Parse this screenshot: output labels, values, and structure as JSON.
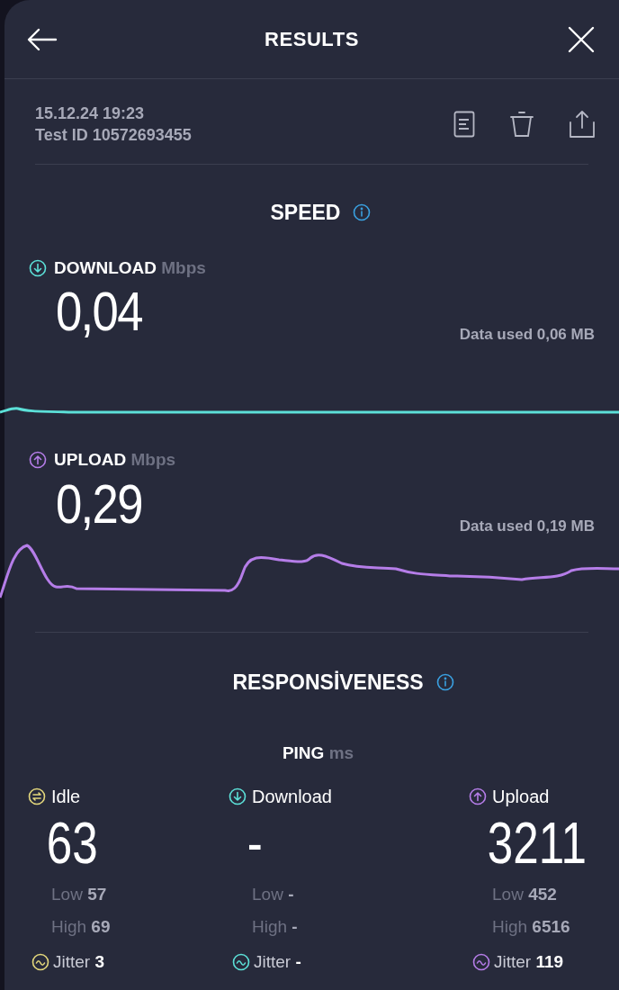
{
  "header": {
    "title": "RESULTS"
  },
  "meta": {
    "datetime": "15.12.24 19:23",
    "test_id": "Test ID 10572693455"
  },
  "speed": {
    "title": "SPEED",
    "items": [
      {
        "kind": "download",
        "label": "DOWNLOAD",
        "unit": "Mbps",
        "value": "0,04",
        "data_used": "Data used 0,06 MB",
        "color": "#5ce0d8"
      },
      {
        "kind": "upload",
        "label": "UPLOAD",
        "unit": "Mbps",
        "value": "0,29",
        "data_used": "Data used 0,19 MB",
        "color": "#b57de8"
      }
    ]
  },
  "responsiveness": {
    "title": "RESPONSİVENESS",
    "ping_label": "PING",
    "ping_unit": "ms",
    "columns": [
      {
        "kind": "idle",
        "label": "Idle",
        "value": "63",
        "low_label": "Low",
        "low": "57",
        "high_label": "High",
        "high": "69",
        "jitter_label": "Jitter",
        "jitter": "3",
        "color": "#e3d77c"
      },
      {
        "kind": "download",
        "label": "Download",
        "value": "-",
        "low_label": "Low",
        "low": "-",
        "high_label": "High",
        "high": "-",
        "jitter_label": "Jitter",
        "jitter": "-",
        "color": "#5ce0d8"
      },
      {
        "kind": "upload",
        "label": "Upload",
        "value": "3211",
        "low_label": "Low",
        "low": "452",
        "high_label": "High",
        "high": "6516",
        "jitter_label": "Jitter",
        "jitter": "119",
        "color": "#b57de8"
      }
    ]
  }
}
